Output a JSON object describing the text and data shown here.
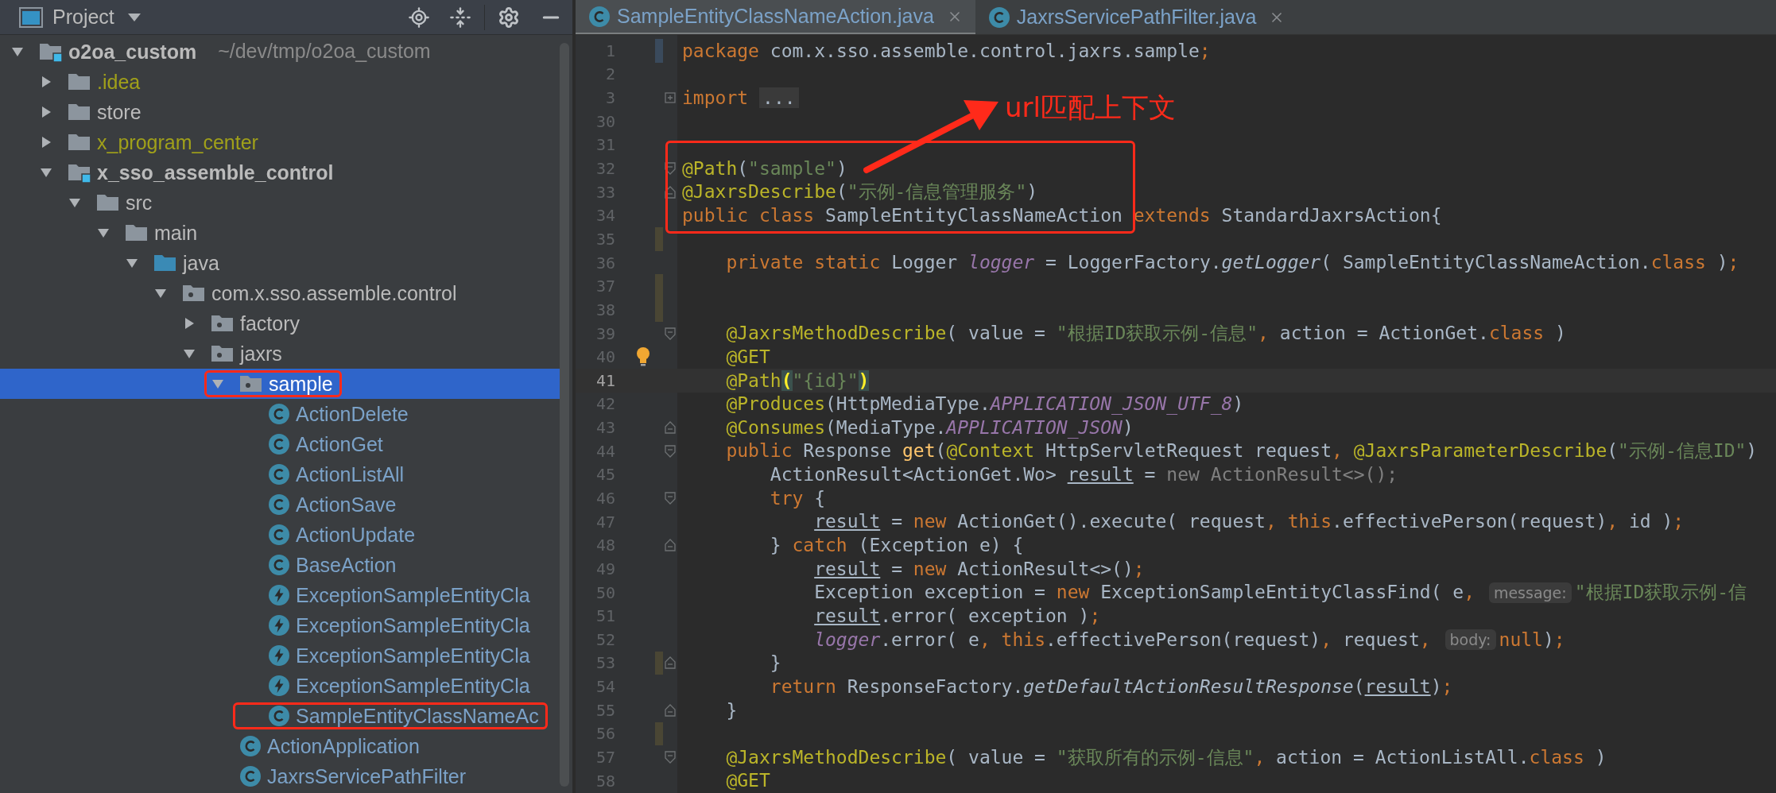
{
  "project_panel": {
    "title": "Project"
  },
  "tree": [
    {
      "label": "o2oa_custom",
      "location": "~/dev/tmp/o2oa_custom",
      "kind": "module",
      "expanded": true,
      "selected": false,
      "highlighted": false,
      "color": "#bbbbbb",
      "children": [
        {
          "label": ".idea",
          "kind": "folder",
          "expanded": false,
          "selected": false,
          "highlighted": false,
          "color": "#a0a01a"
        },
        {
          "label": "store",
          "kind": "folder",
          "expanded": false,
          "selected": false,
          "highlighted": false,
          "color": "#bbbbbb"
        },
        {
          "label": "x_program_center",
          "kind": "folder",
          "expanded": false,
          "selected": false,
          "highlighted": false,
          "color": "#a0a01a"
        },
        {
          "label": "x_sso_assemble_control",
          "kind": "module",
          "expanded": true,
          "selected": false,
          "highlighted": false,
          "color": "#bbbbbb",
          "children": [
            {
              "label": "src",
              "kind": "folder",
              "expanded": true,
              "selected": false,
              "highlighted": false,
              "color": "#bbbbbb",
              "children": [
                {
                  "label": "main",
                  "kind": "folder",
                  "expanded": true,
                  "selected": false,
                  "highlighted": false,
                  "color": "#bbbbbb",
                  "children": [
                    {
                      "label": "java",
                      "kind": "source",
                      "expanded": true,
                      "selected": false,
                      "highlighted": false,
                      "color": "#bbbbbb",
                      "children": [
                        {
                          "label": "com.x.sso.assemble.control",
                          "kind": "package",
                          "expanded": true,
                          "selected": false,
                          "highlighted": false,
                          "color": "#bbbbbb",
                          "children": [
                            {
                              "label": "factory",
                              "kind": "package",
                              "expanded": false,
                              "selected": false,
                              "highlighted": false,
                              "color": "#bbbbbb"
                            },
                            {
                              "label": "jaxrs",
                              "kind": "package",
                              "expanded": true,
                              "selected": false,
                              "highlighted": false,
                              "color": "#bbbbbb",
                              "children": [
                                {
                                  "label": "sample",
                                  "kind": "package",
                                  "expanded": true,
                                  "selected": true,
                                  "highlighted": true,
                                  "children": [
                                    {
                                      "label": "ActionDelete",
                                      "kind": "class",
                                      "selected": false,
                                      "highlighted": false,
                                      "color": "#7ba2c8"
                                    },
                                    {
                                      "label": "ActionGet",
                                      "kind": "class",
                                      "selected": false,
                                      "highlighted": false,
                                      "color": "#7ba2c8"
                                    },
                                    {
                                      "label": "ActionListAll",
                                      "kind": "class",
                                      "selected": false,
                                      "highlighted": false,
                                      "color": "#7ba2c8"
                                    },
                                    {
                                      "label": "ActionSave",
                                      "kind": "class",
                                      "selected": false,
                                      "highlighted": false,
                                      "color": "#7ba2c8"
                                    },
                                    {
                                      "label": "ActionUpdate",
                                      "kind": "class",
                                      "selected": false,
                                      "highlighted": false,
                                      "color": "#7ba2c8"
                                    },
                                    {
                                      "label": "BaseAction",
                                      "kind": "class",
                                      "selected": false,
                                      "highlighted": false,
                                      "color": "#7ba2c8"
                                    },
                                    {
                                      "label": "ExceptionSampleEntityCla",
                                      "kind": "exception",
                                      "selected": false,
                                      "highlighted": false,
                                      "color": "#7ba2c8"
                                    },
                                    {
                                      "label": "ExceptionSampleEntityCla",
                                      "kind": "exception",
                                      "selected": false,
                                      "highlighted": false,
                                      "color": "#7ba2c8"
                                    },
                                    {
                                      "label": "ExceptionSampleEntityCla",
                                      "kind": "exception",
                                      "selected": false,
                                      "highlighted": false,
                                      "color": "#7ba2c8"
                                    },
                                    {
                                      "label": "ExceptionSampleEntityCla",
                                      "kind": "exception",
                                      "selected": false,
                                      "highlighted": false,
                                      "color": "#7ba2c8"
                                    },
                                    {
                                      "label": "SampleEntityClassNameAc",
                                      "kind": "class",
                                      "selected": false,
                                      "highlighted": true,
                                      "color": "#7ba2c8"
                                    }
                                  ]
                                },
                                {
                                  "label": "ActionApplication",
                                  "kind": "class",
                                  "selected": false,
                                  "highlighted": false,
                                  "color": "#7ba2c8"
                                },
                                {
                                  "label": "JaxrsServicePathFilter",
                                  "kind": "class",
                                  "selected": false,
                                  "highlighted": false,
                                  "color": "#7ba2c8"
                                }
                              ]
                            }
                          ]
                        }
                      ]
                    }
                  ]
                }
              ]
            }
          ]
        }
      ]
    }
  ],
  "tabs": [
    {
      "label": "SampleEntityClassNameAction.java",
      "selected": true
    },
    {
      "label": "JaxrsServicePathFilter.java",
      "selected": false
    }
  ],
  "callout": {
    "label": "url匹配上下文"
  },
  "lines": [
    {
      "number": "1",
      "current": false,
      "modified": true,
      "tokens": [
        {
          "text": "package",
          "kind": "keyword"
        },
        {
          "text": " com.x.sso.assemble.control.jaxrs.sample",
          "kind": "plain"
        },
        {
          "text": ";",
          "kind": "keyword"
        }
      ]
    },
    {
      "number": "2",
      "current": false
    },
    {
      "number": "3",
      "current": false,
      "folded": true,
      "tokens": [
        {
          "text": "import",
          "kind": "keyword"
        },
        {
          "text": "...",
          "kind": "folded"
        }
      ]
    },
    {
      "number": "30",
      "current": false
    },
    {
      "number": "31",
      "current": false
    },
    {
      "number": "32",
      "current": false,
      "fold_start": true,
      "tokens": [
        {
          "text": "@Path",
          "kind": "annotation"
        },
        {
          "text": "(",
          "kind": "plain"
        },
        {
          "text": "\"sample\"",
          "kind": "string"
        },
        {
          "text": ")",
          "kind": "plain"
        }
      ]
    },
    {
      "number": "33",
      "current": false,
      "fold_end": true,
      "tokens": [
        {
          "text": "@JaxrsDescribe",
          "kind": "annotation"
        },
        {
          "text": "(",
          "kind": "plain"
        },
        {
          "text": "\"示例-信息管理服务\"",
          "kind": "string"
        },
        {
          "text": ")",
          "kind": "plain"
        }
      ]
    },
    {
      "number": "34",
      "current": false,
      "tokens": [
        {
          "text": "public class",
          "kind": "keyword"
        },
        {
          "text": " SampleEntityClassNameAction ",
          "kind": "plain"
        },
        {
          "text": "extends",
          "kind": "keyword"
        },
        {
          "text": " StandardJaxrsAction{",
          "kind": "plain"
        }
      ]
    },
    {
      "number": "35",
      "current": false,
      "changed": true
    },
    {
      "number": "36",
      "current": false,
      "tokens": [
        {
          "text": "    private static",
          "kind": "keyword"
        },
        {
          "text": " Logger ",
          "kind": "plain"
        },
        {
          "text": "logger",
          "kind": "field"
        },
        {
          "text": " = LoggerFactory.",
          "kind": "plain"
        },
        {
          "text": "getLogger",
          "kind": "static"
        },
        {
          "text": "( SampleEntityClassNameAction.",
          "kind": "plain"
        },
        {
          "text": "class",
          "kind": "keyword"
        },
        {
          "text": " )",
          "kind": "plain"
        },
        {
          "text": ";",
          "kind": "keyword"
        }
      ]
    },
    {
      "number": "37",
      "current": false,
      "changed": true
    },
    {
      "number": "38",
      "current": false,
      "changed": true
    },
    {
      "number": "39",
      "current": false,
      "fold_start": true,
      "tokens": [
        {
          "text": "    @JaxrsMethodDescribe",
          "kind": "annotation"
        },
        {
          "text": "( value = ",
          "kind": "plain"
        },
        {
          "text": "\"根据ID获取示例-信息\"",
          "kind": "string"
        },
        {
          "text": ", ",
          "kind": "keyword"
        },
        {
          "text": "action = ActionGet.",
          "kind": "plain"
        },
        {
          "text": "class",
          "kind": "keyword"
        },
        {
          "text": " )",
          "kind": "plain"
        }
      ]
    },
    {
      "number": "40",
      "current": false,
      "bulb": true,
      "tokens": [
        {
          "text": "    @GET",
          "kind": "annotation"
        }
      ]
    },
    {
      "number": "41",
      "current": true,
      "tokens": [
        {
          "text": "    @Path",
          "kind": "annotation"
        },
        {
          "text": "(",
          "kind": "brace"
        },
        {
          "text": "\"{id}\"",
          "kind": "string"
        },
        {
          "text": ")",
          "kind": "brace"
        }
      ]
    },
    {
      "number": "42",
      "current": false,
      "tokens": [
        {
          "text": "    @Produces",
          "kind": "annotation"
        },
        {
          "text": "(HttpMediaType.",
          "kind": "plain"
        },
        {
          "text": "APPLICATION_JSON_UTF_8",
          "kind": "field"
        },
        {
          "text": ")",
          "kind": "plain"
        }
      ]
    },
    {
      "number": "43",
      "current": false,
      "fold_end": true,
      "tokens": [
        {
          "text": "    @Consumes",
          "kind": "annotation"
        },
        {
          "text": "(MediaType.",
          "kind": "plain"
        },
        {
          "text": "APPLICATION_JSON",
          "kind": "field"
        },
        {
          "text": ")",
          "kind": "plain"
        }
      ]
    },
    {
      "number": "44",
      "current": false,
      "fold_start": true,
      "tokens": [
        {
          "text": "    public",
          "kind": "keyword"
        },
        {
          "text": " Response ",
          "kind": "plain"
        },
        {
          "text": "get",
          "kind": "method"
        },
        {
          "text": "(",
          "kind": "plain"
        },
        {
          "text": "@Context",
          "kind": "annotation"
        },
        {
          "text": " HttpServletRequest request",
          "kind": "plain"
        },
        {
          "text": ", ",
          "kind": "keyword"
        },
        {
          "text": "@JaxrsParameterDescribe",
          "kind": "annotation"
        },
        {
          "text": "(",
          "kind": "plain"
        },
        {
          "text": "\"示例-信息ID\"",
          "kind": "string"
        },
        {
          "text": ")",
          "kind": "plain"
        }
      ]
    },
    {
      "number": "45",
      "current": false,
      "tokens": [
        {
          "text": "        ActionResult<ActionGet.Wo> ",
          "kind": "plain"
        },
        {
          "text": "result",
          "kind": "underlined"
        },
        {
          "text": " = ",
          "kind": "plain"
        },
        {
          "text": "new ActionResult<>();",
          "kind": "dim"
        }
      ]
    },
    {
      "number": "46",
      "current": false,
      "fold_start": true,
      "tokens": [
        {
          "text": "        try",
          "kind": "keyword"
        },
        {
          "text": " {",
          "kind": "plain"
        }
      ]
    },
    {
      "number": "47",
      "current": false,
      "tokens": [
        {
          "text": "            result",
          "kind": "underlined"
        },
        {
          "text": " = ",
          "kind": "plain"
        },
        {
          "text": "new",
          "kind": "keyword"
        },
        {
          "text": " ActionGet().execute( request",
          "kind": "plain"
        },
        {
          "text": ", ",
          "kind": "keyword"
        },
        {
          "text": "this",
          "kind": "keyword"
        },
        {
          "text": ".effectivePerson(request)",
          "kind": "plain"
        },
        {
          "text": ", ",
          "kind": "keyword"
        },
        {
          "text": "id )",
          "kind": "plain"
        },
        {
          "text": ";",
          "kind": "keyword"
        }
      ]
    },
    {
      "number": "48",
      "current": false,
      "fold_end": true,
      "tokens": [
        {
          "text": "        } ",
          "kind": "plain"
        },
        {
          "text": "catch",
          "kind": "keyword"
        },
        {
          "text": " (Exception e) {",
          "kind": "plain"
        }
      ]
    },
    {
      "number": "49",
      "current": false,
      "tokens": [
        {
          "text": "            result",
          "kind": "underlined"
        },
        {
          "text": " = ",
          "kind": "plain"
        },
        {
          "text": "new",
          "kind": "keyword"
        },
        {
          "text": " ActionResult<>()",
          "kind": "plain"
        },
        {
          "text": ";",
          "kind": "keyword"
        }
      ]
    },
    {
      "number": "50",
      "current": false,
      "tokens": [
        {
          "text": "            Exception exception = ",
          "kind": "plain"
        },
        {
          "text": "new",
          "kind": "keyword"
        },
        {
          "text": " ExceptionSampleEntityClassFind( e",
          "kind": "plain"
        },
        {
          "text": ", ",
          "kind": "keyword"
        },
        {
          "text": "message:",
          "kind": "hint"
        },
        {
          "text": "\"根据ID获取示例-信",
          "kind": "string"
        }
      ]
    },
    {
      "number": "51",
      "current": false,
      "tokens": [
        {
          "text": "            result",
          "kind": "underlined"
        },
        {
          "text": ".error( exception )",
          "kind": "plain"
        },
        {
          "text": ";",
          "kind": "keyword"
        }
      ]
    },
    {
      "number": "52",
      "current": false,
      "tokens": [
        {
          "text": "            logger",
          "kind": "field"
        },
        {
          "text": ".error( e",
          "kind": "plain"
        },
        {
          "text": ", ",
          "kind": "keyword"
        },
        {
          "text": "this",
          "kind": "keyword"
        },
        {
          "text": ".effectivePerson(request)",
          "kind": "plain"
        },
        {
          "text": ", ",
          "kind": "keyword"
        },
        {
          "text": "request",
          "kind": "plain"
        },
        {
          "text": ", ",
          "kind": "keyword"
        },
        {
          "text": "body:",
          "kind": "hint"
        },
        {
          "text": "null",
          "kind": "keyword"
        },
        {
          "text": ")",
          "kind": "plain"
        },
        {
          "text": ";",
          "kind": "keyword"
        }
      ]
    },
    {
      "number": "53",
      "current": false,
      "fold_end": true,
      "changed": true,
      "tokens": [
        {
          "text": "        }",
          "kind": "plain"
        }
      ]
    },
    {
      "number": "54",
      "current": false,
      "tokens": [
        {
          "text": "        return",
          "kind": "keyword"
        },
        {
          "text": " ResponseFactory.",
          "kind": "plain"
        },
        {
          "text": "getDefaultActionResultResponse",
          "kind": "static"
        },
        {
          "text": "(",
          "kind": "plain"
        },
        {
          "text": "result",
          "kind": "underlined"
        },
        {
          "text": ")",
          "kind": "plain"
        },
        {
          "text": ";",
          "kind": "keyword"
        }
      ]
    },
    {
      "number": "55",
      "current": false,
      "fold_end": true,
      "tokens": [
        {
          "text": "    }",
          "kind": "plain"
        }
      ]
    },
    {
      "number": "56",
      "current": false,
      "changed": true
    },
    {
      "number": "57",
      "current": false,
      "fold_start": true,
      "tokens": [
        {
          "text": "    @JaxrsMethodDescribe",
          "kind": "annotation"
        },
        {
          "text": "( value = ",
          "kind": "plain"
        },
        {
          "text": "\"获取所有的示例-信息\"",
          "kind": "string"
        },
        {
          "text": ", ",
          "kind": "keyword"
        },
        {
          "text": "action = ActionListAll.",
          "kind": "plain"
        },
        {
          "text": "class",
          "kind": "keyword"
        },
        {
          "text": " )",
          "kind": "plain"
        }
      ]
    },
    {
      "number": "58",
      "current": false,
      "tokens": [
        {
          "text": "    @GET",
          "kind": "annotation"
        }
      ]
    }
  ]
}
